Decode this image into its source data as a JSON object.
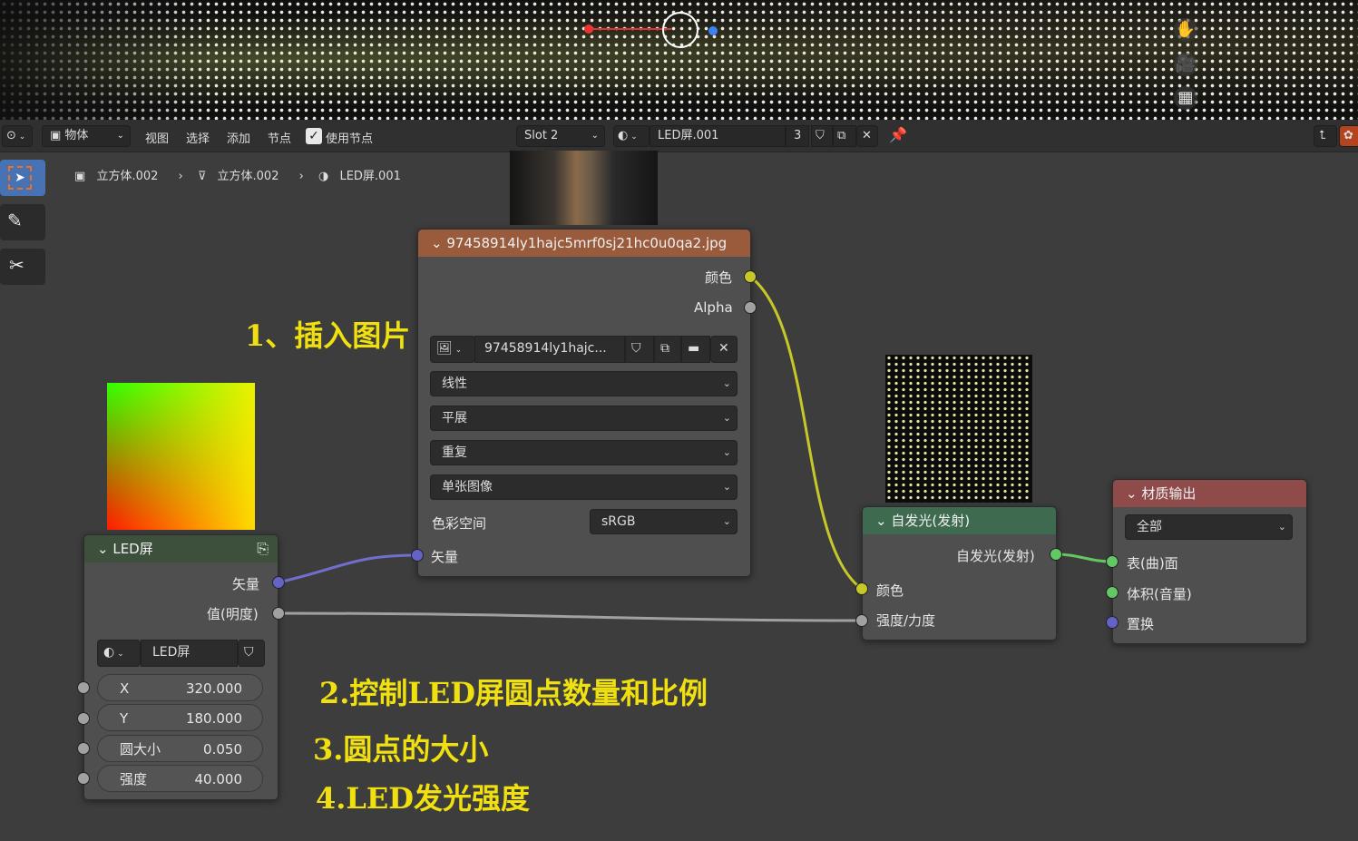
{
  "header": {
    "editor_type": "⊙",
    "mode": "物体",
    "menus": [
      "视图",
      "选择",
      "添加",
      "节点"
    ],
    "use_nodes_label": "使用节点",
    "use_nodes_checked": true,
    "slot": "Slot 2",
    "material_name": "LED屏.001",
    "user_count": "3"
  },
  "breadcrumb": {
    "object": "立方体.002",
    "mesh": "立方体.002",
    "material": "LED屏.001"
  },
  "image_node": {
    "title": "97458914ly1hajc5mrf0sj21hc0u0qa2.jpg",
    "out_color": "颜色",
    "out_alpha": "Alpha",
    "image_name": "97458914ly1hajc...",
    "interpolation": "线性",
    "projection": "平展",
    "extension": "重复",
    "source": "单张图像",
    "color_space_label": "色彩空间",
    "color_space": "sRGB",
    "in_vector": "矢量"
  },
  "group_node": {
    "title": "LED屏",
    "out_vector": "矢量",
    "out_value": "值(明度)",
    "group_name": "LED屏",
    "inputs": [
      {
        "label": "X",
        "value": "320.000"
      },
      {
        "label": "Y",
        "value": "180.000"
      },
      {
        "label": "圆大小",
        "value": "0.050"
      },
      {
        "label": "强度",
        "value": "40.000"
      }
    ]
  },
  "emission_node": {
    "title": "自发光(发射)",
    "out_emission": "自发光(发射)",
    "in_color": "颜色",
    "in_strength": "强度/力度"
  },
  "output_node": {
    "title": "材质输出",
    "target": "全部",
    "in_surface": "表(曲)面",
    "in_volume": "体积(音量)",
    "in_displacement": "置换"
  },
  "annotations": {
    "a1": "1、插入图片",
    "a2": "2.控制LED屏圆点数量和比例",
    "a3": "3.圆点的大小",
    "a4": "4.LED发光强度"
  },
  "colors": {
    "image_header": "#9a5a3c",
    "group_header": "#3c503c",
    "emission_header": "#3e6b50",
    "output_header": "#8f4a4a",
    "annotation": "#f0e010"
  }
}
